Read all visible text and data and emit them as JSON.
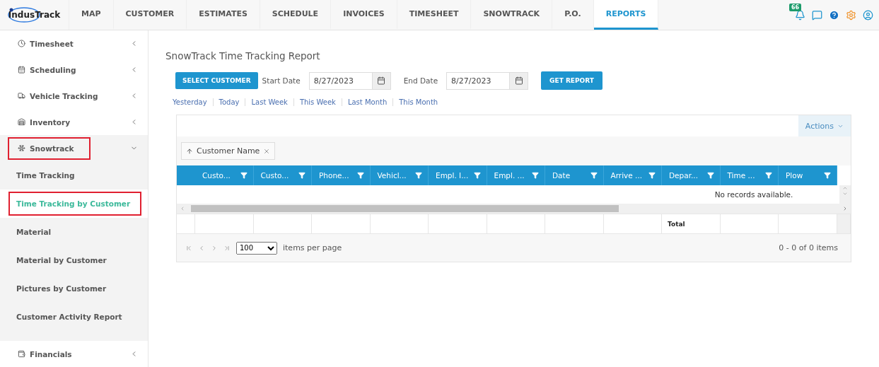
{
  "logo": {
    "text": "IndusTrack"
  },
  "nav": [
    {
      "label": "MAP",
      "selected": false
    },
    {
      "label": "CUSTOMER",
      "selected": false
    },
    {
      "label": "ESTIMATES",
      "selected": false
    },
    {
      "label": "SCHEDULE",
      "selected": false
    },
    {
      "label": "INVOICES",
      "selected": false
    },
    {
      "label": "TIMESHEET",
      "selected": false
    },
    {
      "label": "SNOWTRACK",
      "selected": false
    },
    {
      "label": "P.O.",
      "selected": false
    },
    {
      "label": "REPORTS",
      "selected": true
    }
  ],
  "notifications": {
    "count": "66"
  },
  "sidebar": {
    "items": [
      {
        "label": "Timesheet",
        "expanded": false,
        "highlighted": false
      },
      {
        "label": "Scheduling",
        "expanded": false,
        "highlighted": false
      },
      {
        "label": "Vehicle Tracking",
        "expanded": false,
        "highlighted": false
      },
      {
        "label": "Inventory",
        "expanded": false,
        "highlighted": false
      },
      {
        "label": "Snowtrack",
        "expanded": true,
        "highlighted": true,
        "children": [
          {
            "label": "Time Tracking",
            "selected": false,
            "highlighted": false
          },
          {
            "label": "Time Tracking by Customer",
            "selected": true,
            "highlighted": true
          },
          {
            "label": "Material",
            "selected": false,
            "highlighted": false
          },
          {
            "label": "Material by Customer",
            "selected": false,
            "highlighted": false
          },
          {
            "label": "Pictures by Customer",
            "selected": false,
            "highlighted": false
          },
          {
            "label": "Customer Activity Report",
            "selected": false,
            "highlighted": false
          }
        ]
      },
      {
        "label": "Financials",
        "expanded": false,
        "highlighted": false
      }
    ]
  },
  "report": {
    "title": "SnowTrack Time Tracking Report",
    "select_customer": "SELECT CUSTOMER",
    "start_label": "Start Date",
    "start_value": "8/27/2023",
    "end_label": "End Date",
    "end_value": "8/27/2023",
    "get_report": "GET REPORT",
    "quick_ranges": [
      "Yesterday",
      "Today",
      "Last Week",
      "This Week",
      "Last Month",
      "This Month"
    ]
  },
  "grid": {
    "actions": "Actions",
    "group_chip": "Customer Name",
    "columns": [
      "Custo...",
      "Custo...",
      "Phone...",
      "Vehicl...",
      "Empl. I...",
      "Empl. ...",
      "Date",
      "Arrive ...",
      "Depar...",
      "Time ...",
      "Plow"
    ],
    "empty_message": "No records available.",
    "footer_total": "Total",
    "page_size": "100",
    "page_size_label": "items per page",
    "summary": "0 - 0 of 0 items"
  }
}
